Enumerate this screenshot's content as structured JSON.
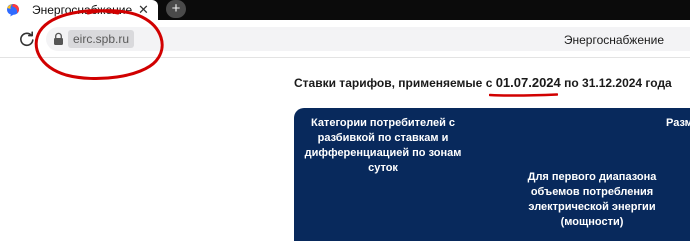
{
  "browser": {
    "tab": {
      "title": "Энергоснабжение",
      "close_glyph": "✕",
      "favicon": "yandex-messenger-icon"
    },
    "new_tab_glyph": "+",
    "address_bar": {
      "url": "eirc.spb.ru",
      "page_title": "Энергоснабжение"
    }
  },
  "page": {
    "heading": {
      "prefix": "Ставки тарифов, применяемые с ",
      "date_start": "01.07.2024",
      "middle": " по ",
      "date_end": "31.12.2024",
      "suffix": " года"
    },
    "table_header": {
      "col_categories": "Категории потребителей с разбивкой по ставкам и дифференциацией по зонам суток",
      "col_size_cut": "Разм",
      "sub_first_range": "Для первого диапазона объемов потребления электрической энергии (мощности)"
    }
  },
  "colors": {
    "tabstrip": "#0b0b0b",
    "table_header_bg": "#08295c",
    "annotation": "#d10000"
  }
}
